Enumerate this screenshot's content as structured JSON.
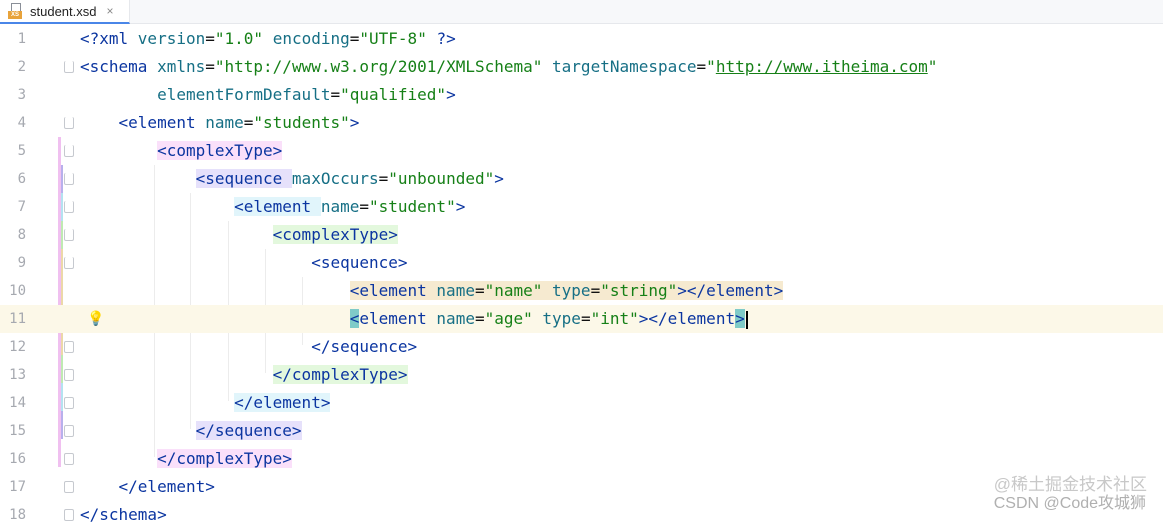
{
  "tab": {
    "file_name": "student.xsd",
    "icon_text": "XS",
    "close_symbol": "×"
  },
  "code_lines": [
    {
      "n": "1",
      "html": "&lt;?xml version=\"1.0\" encoding=\"UTF-8\" ?&gt;"
    },
    {
      "n": "2",
      "text": "<schema xmlns=\"http://www.w3.org/2001/XMLSchema\" targetNamespace=\"http://www.itheima.com\""
    },
    {
      "n": "3",
      "text": "        elementFormDefault=\"qualified\">"
    },
    {
      "n": "4",
      "text": "    <element name=\"students\">"
    },
    {
      "n": "5",
      "text": "        <complexType>"
    },
    {
      "n": "6",
      "text": "            <sequence maxOccurs=\"unbounded\">"
    },
    {
      "n": "7",
      "text": "                <element name=\"student\">"
    },
    {
      "n": "8",
      "text": "                    <complexType>"
    },
    {
      "n": "9",
      "text": "                        <sequence>"
    },
    {
      "n": "10",
      "text": "                            <element name=\"name\" type=\"string\"></element>"
    },
    {
      "n": "11",
      "text": "                            <element name=\"age\" type=\"int\"></element>"
    },
    {
      "n": "12",
      "text": "                        </sequence>"
    },
    {
      "n": "13",
      "text": "                    </complexType>"
    },
    {
      "n": "14",
      "text": "                </element>"
    },
    {
      "n": "15",
      "text": "            </sequence>"
    },
    {
      "n": "16",
      "text": "        </complexType>"
    },
    {
      "n": "17",
      "text": "    </element>"
    },
    {
      "n": "18",
      "text": "</schema>"
    }
  ],
  "watermark": {
    "line1": "@稀土掘金技术社区",
    "line2": "CSDN @Code攻城狮"
  },
  "colors": {
    "tag": "#0b35a0",
    "attribute": "#166f85",
    "value": "#168017",
    "caret_line": "#fcf8e8",
    "tab_accent": "#4a86e8",
    "lightbulb": "#f2b705"
  }
}
